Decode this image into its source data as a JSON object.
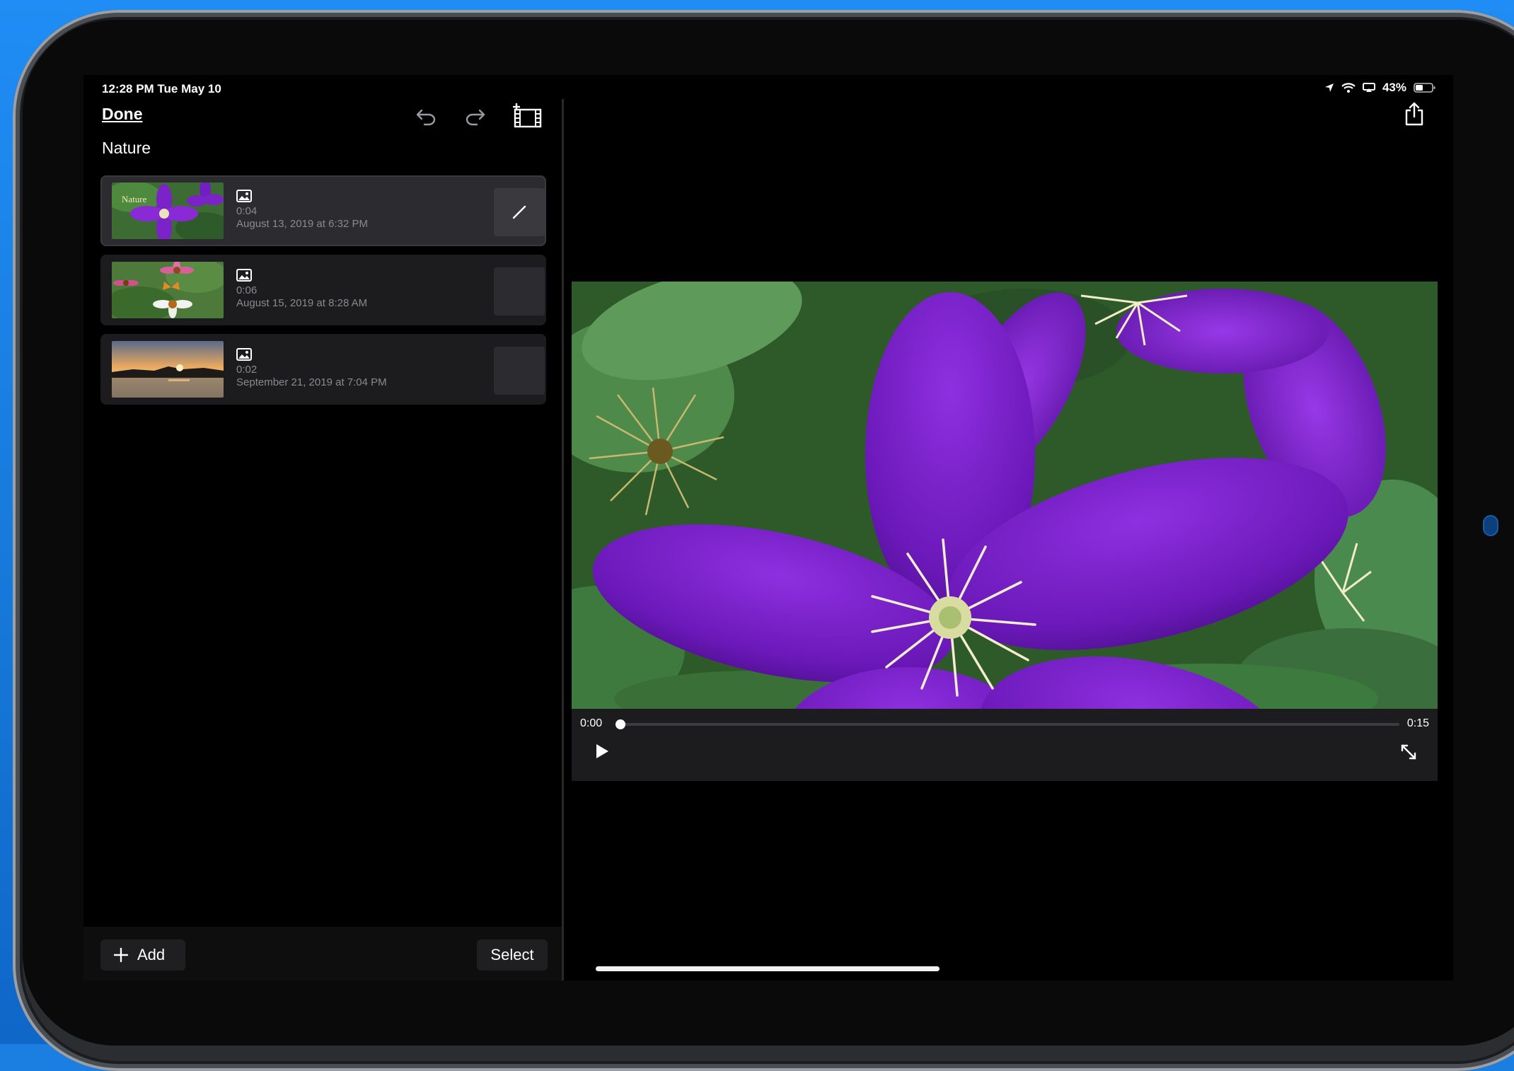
{
  "status_bar": {
    "time_date": "12:28 PM   Tue May 10",
    "battery": "43%"
  },
  "toolbar": {
    "done_label": "Done",
    "icons": [
      "undo-icon",
      "redo-icon",
      "add-clip-icon",
      "share-icon"
    ]
  },
  "project": {
    "title": "Nature"
  },
  "clips": [
    {
      "thumbnail_text": "Nature",
      "duration": "0:04",
      "date": "August 13, 2019 at 6:32 PM",
      "selected": true,
      "icon": "photo-icon"
    },
    {
      "duration": "0:06",
      "date": "August 15, 2019 at 8:28 AM",
      "selected": false,
      "icon": "photo-icon"
    },
    {
      "duration": "0:02",
      "date": "September 21, 2019 at 7:04 PM",
      "selected": false,
      "icon": "photo-icon"
    }
  ],
  "bottom_bar": {
    "add_label": "Add",
    "select_label": "Select"
  },
  "player": {
    "current_time": "0:00",
    "total_time": "0:15",
    "progress": 0.0,
    "icons": [
      "play-icon",
      "fullscreen-icon"
    ]
  },
  "colors": {
    "background": "#000000",
    "panel": "#1c1c1e",
    "accent_purple": "#7a1fc4",
    "secondary_text": "#8a8a8e"
  }
}
